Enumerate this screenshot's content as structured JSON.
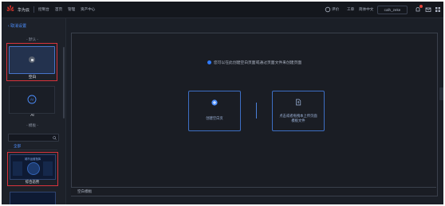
{
  "topbar": {
    "brand": "华为云",
    "nav": [
      "控制台",
      "首页",
      "管理",
      "资产中心"
    ],
    "right": [
      "评价",
      "工单",
      "简体中文"
    ],
    "username": "calh_zeke"
  },
  "sidebar": {
    "back_label": "取消设置",
    "section_default": "- 默认 -",
    "blank_label": "空白",
    "ai_label": "AI",
    "section_template": "- 模板 -",
    "search_placeholder": "",
    "template_tag": "全部",
    "template_card_text": "城市运营指挥",
    "template_label": "综合态势"
  },
  "canvas": {
    "hint": "您可以在此创建空白页面或通过页面文件来创建页面",
    "option_create": "创建空白页",
    "option_upload_line1": "点击或者拖拽本上传页面",
    "option_upload_line2": "模板文件",
    "bottom_label": "空白模板"
  },
  "colors": {
    "accent": "#4d8fff",
    "selection_outline": "#d8333c",
    "background": "#1b1f27"
  }
}
